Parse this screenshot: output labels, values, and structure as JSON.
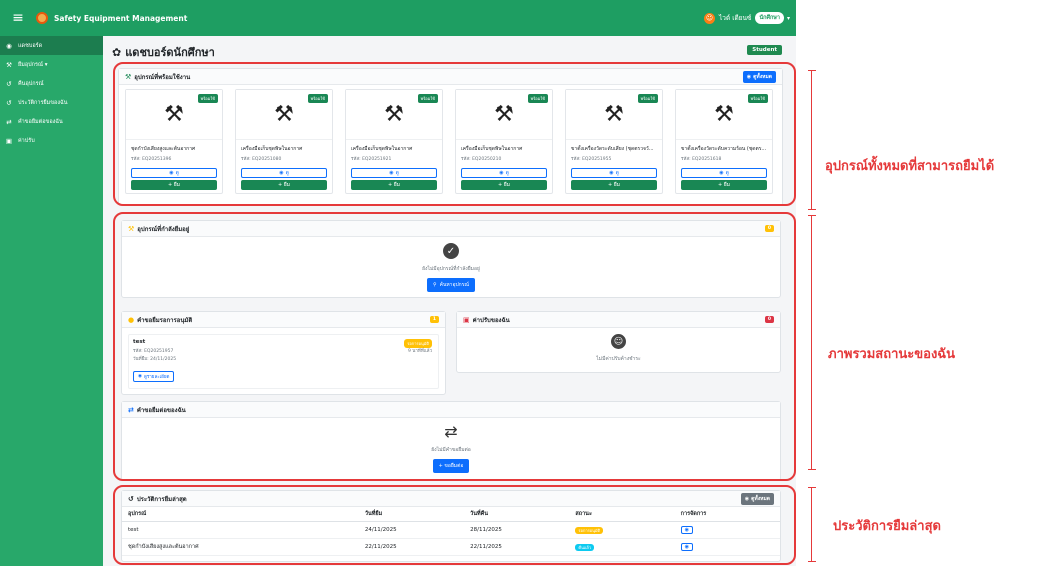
{
  "topbar": {
    "menu_icon": "hamburger-icon",
    "app_title": "Safety Equipment Management",
    "user_name": "ไวด์ เดียนซ์",
    "user_role": "นักศึกษา"
  },
  "sidebar": {
    "items": [
      {
        "label": "แดชบอร์ด",
        "icon": "dashboard-icon",
        "active": true
      },
      {
        "label": "ยืมอุปกรณ์ ▾",
        "icon": "tools-icon"
      },
      {
        "label": "คืนอุปกรณ์",
        "icon": "return-icon"
      },
      {
        "label": "ประวัติการยืมของฉัน",
        "icon": "history-icon"
      },
      {
        "label": "คำขอยืมต่อของฉัน",
        "icon": "swap-icon"
      },
      {
        "label": "ค่าปรับ",
        "icon": "fine-icon"
      }
    ]
  },
  "page": {
    "title": "แดชบอร์ดนักศึกษา",
    "role_badge": "Student"
  },
  "available": {
    "title": "อุปกรณ์ที่พร้อมใช้งาน",
    "view_all": "ดูทั้งหมด",
    "items": [
      {
        "name": "ชุดกำบังเสียงสูงและต้นอากาศ",
        "code": "รหัส: EQ20251396",
        "badge": "พร้อมใช้",
        "view": "ดู",
        "borrow": "+ ยืม"
      },
      {
        "name": "เครื่องมือเก็บชุดพิษในอากาศ",
        "code": "รหัส: EQ20251080",
        "badge": "พร้อมใช้",
        "view": "ดู",
        "borrow": "+ ยืม"
      },
      {
        "name": "เครื่องมือเก็บชุดพิษในอากาศ",
        "code": "รหัส: EQ20251921",
        "badge": "พร้อมใช้",
        "view": "ดู",
        "borrow": "+ ยืม"
      },
      {
        "name": "เครื่องมือเก็บชุดพิษในอากาศ",
        "code": "รหัส: EQ20250210",
        "badge": "พร้อมใช้",
        "view": "ดู",
        "borrow": "+ ยืม"
      },
      {
        "name": "ขาตั้งเครื่องวัดระดับเสียง (ชุดตรวจวั...",
        "code": "รหัส: EQ20251955",
        "badge": "พร้อมใช้",
        "view": "ดู",
        "borrow": "+ ยืม"
      },
      {
        "name": "ขาตั้งเครื่องวัดระดับความร้อน (ชุดตร...",
        "code": "รหัส: EQ20251618",
        "badge": "พร้อมใช้",
        "view": "ดู",
        "borrow": "+ ยืม"
      }
    ]
  },
  "borrowing": {
    "title": "อุปกรณ์ที่กำลังยืมอยู่",
    "count": "0",
    "empty_text": "ยังไม่มีอุปกรณ์ที่กำลังยืมอยู่",
    "search_button": "ค้นหาอุปกรณ์"
  },
  "pending": {
    "title": "คำขอยืมรอการอนุมัติ",
    "count": "1",
    "item_name": "test",
    "item_code": "รหัส: EQ20251957",
    "item_date": "วันที่ยืม: 24/11/2025",
    "item_status": "รอการอนุมัติ",
    "item_ago": "9 นาทีที่แล้ว",
    "detail_button": "ดูรายละเอียด"
  },
  "fines": {
    "title": "ค่าปรับของฉัน",
    "count": "0",
    "empty_text": "ไม่มีค่าปรับค้างชำระ"
  },
  "extensions": {
    "title": "คำขอยืมต่อของฉัน",
    "empty_text": "ยังไม่มีคำขอยืมต่อ",
    "button": "+ ขอยืมต่อ"
  },
  "history": {
    "title": "ประวัติการยืมล่าสุด",
    "view_all": "ดูทั้งหมด",
    "columns": [
      "อุปกรณ์",
      "วันที่ยืม",
      "วันที่คืน",
      "สถานะ",
      "การจัดการ"
    ],
    "rows": [
      {
        "name": "test",
        "borrow_date": "24/11/2025",
        "return_date": "28/11/2025",
        "status": "รอการอนุมัติ",
        "status_type": "warning"
      },
      {
        "name": "ชุดกำบังเสียงสูงและต้นอากาศ",
        "borrow_date": "22/11/2025",
        "return_date": "22/11/2025",
        "status": "คืนแล้ว",
        "status_type": "info"
      }
    ]
  },
  "annotations": {
    "label_1": "อุปกรณ์ทั้งหมดที่สามารถยืมได้",
    "label_2": "ภาพรวมสถานะของฉัน",
    "label_3": "ประวัติการยืมล่าสุด"
  },
  "colors": {
    "brand_green": "#1e9e62",
    "sidebar_green": "#28a86a",
    "annotation_red": "#e5393a",
    "primary_blue": "#0d6efd"
  }
}
